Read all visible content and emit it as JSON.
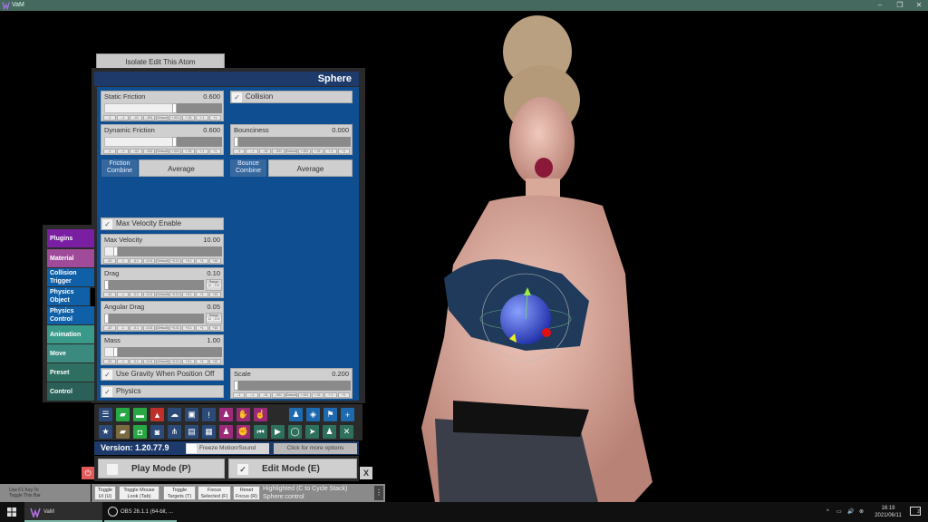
{
  "window": {
    "title": "VaM",
    "controls": [
      "–",
      "❐",
      "✕"
    ]
  },
  "isolate_button": "Isolate Edit This Atom",
  "panel": {
    "title": "Sphere"
  },
  "step_labels": [
    "-1",
    "-.1",
    "-.01",
    "-.001",
    "Default",
    "+.001",
    "+.01",
    "+.1",
    "+1"
  ],
  "step_labels_big": [
    "-10",
    "-1",
    "-0.1",
    "-0.01",
    "Default",
    "+0.01",
    "+0.1",
    "+1",
    "+10"
  ],
  "range_label": "Range",
  "range_opts": [
    "1X",
    "10X"
  ],
  "sliders": {
    "static_friction": {
      "label": "Static Friction",
      "value": "0.600",
      "fraction": 0.6
    },
    "dynamic_friction": {
      "label": "Dynamic Friction",
      "value": "0.600",
      "fraction": 0.6
    },
    "bounciness": {
      "label": "Bounciness",
      "value": "0.000",
      "fraction": 0.0
    },
    "max_velocity": {
      "label": "Max Velocity",
      "value": "10.00",
      "fraction": 0.1
    },
    "drag": {
      "label": "Drag",
      "value": "0.10",
      "fraction": 0.01
    },
    "angular_drag": {
      "label": "Angular Drag",
      "value": "0.05",
      "fraction": 0.005
    },
    "mass": {
      "label": "Mass",
      "value": "1.00",
      "fraction": 0.1
    },
    "scale": {
      "label": "Scale",
      "value": "0.200",
      "fraction": 0.02
    }
  },
  "checkboxes": {
    "collision": {
      "label": "Collision",
      "checked": true,
      "mark": "✓"
    },
    "max_velocity_enable": {
      "label": "Max Velocity Enable",
      "checked": true,
      "mark": "✓"
    },
    "use_gravity": {
      "label": "Use Gravity When Position Off",
      "checked": true,
      "mark": "✓"
    },
    "physics": {
      "label": "Physics",
      "checked": true,
      "mark": "✓"
    }
  },
  "combos": {
    "friction": {
      "label": "Friction Combine",
      "value": "Average"
    },
    "bounce": {
      "label": "Bounce Combine",
      "value": "Average"
    }
  },
  "tabs": [
    {
      "label": "Plugins",
      "color": "#7b1fa2"
    },
    {
      "label": "Material",
      "color": "#a04a9a"
    },
    {
      "label": "Collision Trigger",
      "color": "#1060a8"
    },
    {
      "label": "Physics Object",
      "color": "#1060a8"
    },
    {
      "label": "Physics Control",
      "color": "#1060a8"
    },
    {
      "label": "Animation",
      "color": "#3a9a8a"
    },
    {
      "label": "Move",
      "color": "#3a8a80"
    },
    {
      "label": "Preset",
      "color": "#2f6f62"
    },
    {
      "label": "Control",
      "color": "#2a6058"
    }
  ],
  "toolbar": {
    "row1": [
      {
        "icon": "menu-icon",
        "glyph": "☰",
        "color": "#2c4a78"
      },
      {
        "icon": "open-scene-icon",
        "glyph": "▰",
        "color": "#28a845"
      },
      {
        "icon": "folder-icon",
        "glyph": "▬",
        "color": "#28a845"
      },
      {
        "icon": "save-icon",
        "glyph": "▲",
        "color": "#c0302a"
      },
      {
        "icon": "cloud-icon",
        "glyph": "☁",
        "color": "#2c4a78"
      },
      {
        "icon": "package-icon",
        "glyph": "▣",
        "color": "#2c4a78"
      },
      {
        "icon": "alert-icon",
        "glyph": "!",
        "color": "#2c4a78"
      },
      {
        "icon": "user-settings-icon",
        "glyph": "♟",
        "color": "#9c2a78"
      },
      {
        "icon": "hand-icon",
        "glyph": "✋",
        "color": "#9c2a78"
      },
      {
        "icon": "pointer-hand-icon",
        "glyph": "☝",
        "color": "#9c2a78"
      },
      {
        "icon": "person-icon",
        "glyph": "♟",
        "color": "#1d6ab0"
      },
      {
        "icon": "unity-icon",
        "glyph": "◈",
        "color": "#1d6ab0"
      },
      {
        "icon": "flag-icon",
        "glyph": "⚑",
        "color": "#1d6ab0"
      },
      {
        "icon": "add-icon",
        "glyph": "+",
        "color": "#1d6ab0"
      }
    ],
    "row2": [
      {
        "icon": "star-icon",
        "glyph": "★",
        "color": "#2c4a78"
      },
      {
        "icon": "load-icon",
        "glyph": "▰",
        "color": "#7a6a40"
      },
      {
        "icon": "folder-camera-icon",
        "glyph": "◘",
        "color": "#28a845"
      },
      {
        "icon": "camera-icon",
        "glyph": "◙",
        "color": "#2c4a78"
      },
      {
        "icon": "share-icon",
        "glyph": "⋔",
        "color": "#2c4a78"
      },
      {
        "icon": "open-box-icon",
        "glyph": "▤",
        "color": "#2c4a78"
      },
      {
        "icon": "document-icon",
        "glyph": "▦",
        "color": "#2c4a78"
      },
      {
        "icon": "user-gear-icon",
        "glyph": "♟",
        "color": "#9c2a78"
      },
      {
        "icon": "grab-hand-icon",
        "glyph": "✊",
        "color": "#9c2a78"
      },
      {
        "icon": "skip-back-icon",
        "glyph": "⏮",
        "color": "#2f6f5e"
      },
      {
        "icon": "play-icon",
        "glyph": "▶",
        "color": "#2f6f5e"
      },
      {
        "icon": "target-icon",
        "glyph": "◯",
        "color": "#2f6f5e"
      },
      {
        "icon": "select-cursor-icon",
        "glyph": "➤",
        "color": "#2f6f5e"
      },
      {
        "icon": "people-icon",
        "glyph": "♟",
        "color": "#2f6f5e"
      },
      {
        "icon": "tools-icon",
        "glyph": "✕",
        "color": "#2f6f5e"
      }
    ]
  },
  "version": "Version: 1.20.77.9",
  "freeze": {
    "label": "Freeze Motion/Sound",
    "checked": false
  },
  "more_options": "Click for more options",
  "play_mode": {
    "label": "Play Mode (P)",
    "checked": false
  },
  "edit_mode": {
    "label": "Edit Mode (E)",
    "checked": true,
    "mark": "✓"
  },
  "power_glyph": "⏻",
  "close_glyph": "X",
  "hint": {
    "line1": "Use F1 Key To",
    "line2": "Toggle This Bar"
  },
  "bottom_buttons": [
    {
      "l1": "Toggle",
      "l2": "UI (U)"
    },
    {
      "l1": "Toggle Mouse",
      "l2": "Look (Tab)"
    },
    {
      "l1": "Toggle",
      "l2": "Targets (T)"
    },
    {
      "l1": "Focus",
      "l2": "Selected (F)"
    },
    {
      "l1": "Reset",
      "l2": "Focus (R)"
    }
  ],
  "highlight": {
    "line1": "Highlighted (C to Cycle Stack)",
    "line2": "Sphere:control"
  },
  "kebab": "⋮",
  "taskbar": {
    "apps": [
      {
        "label": "VaM"
      },
      {
        "label": "OBS 26.1.1 (64-bit, ..."
      }
    ],
    "time": "16:19",
    "date": "2021/06/11",
    "notif_count": "2",
    "tray": [
      "^",
      "▭",
      "🔊",
      "⊗"
    ]
  }
}
